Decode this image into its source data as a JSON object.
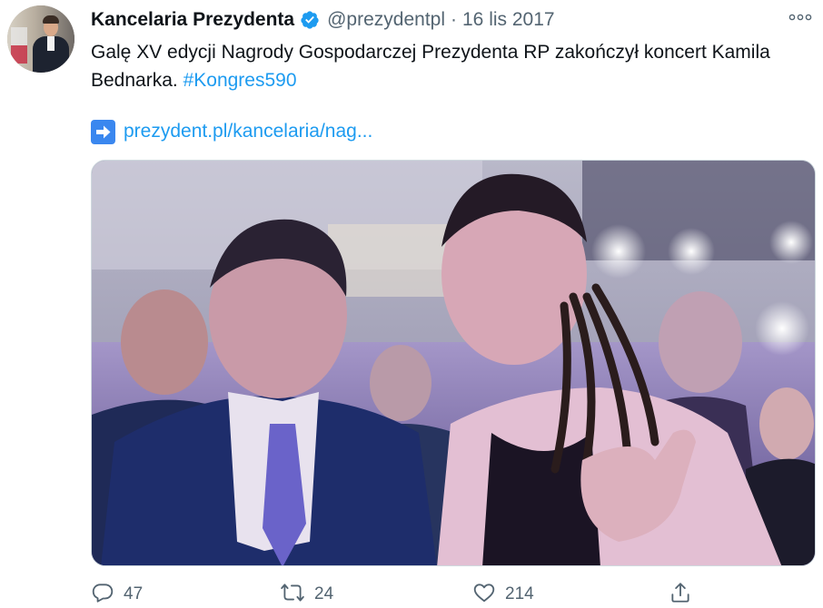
{
  "account": {
    "name": "Kancelaria Prezydenta",
    "handle": "@prezydentpl",
    "separator": "·",
    "date": "16 lis 2017",
    "verified": true
  },
  "tweet": {
    "text": "Galę XV edycji Nagrody Gospodarczej Prezydenta RP zakończył koncert Kamila Bednarka.",
    "hashtag": "#Kongres590",
    "link_text": "prezydent.pl/kancelaria/nag..."
  },
  "icons": {
    "verified": "verified-badge-icon",
    "more": "more-options-icon",
    "link_arrow": "right-arrow-icon",
    "reply": "reply-icon",
    "retweet": "retweet-icon",
    "like": "like-icon",
    "share": "share-icon"
  },
  "actions": {
    "reply_count": "47",
    "retweet_count": "24",
    "like_count": "214"
  },
  "colors": {
    "accent": "#1d9bf0",
    "muted": "#536471",
    "text": "#0f1419",
    "link_arrow_bg": "#3a87ef"
  }
}
